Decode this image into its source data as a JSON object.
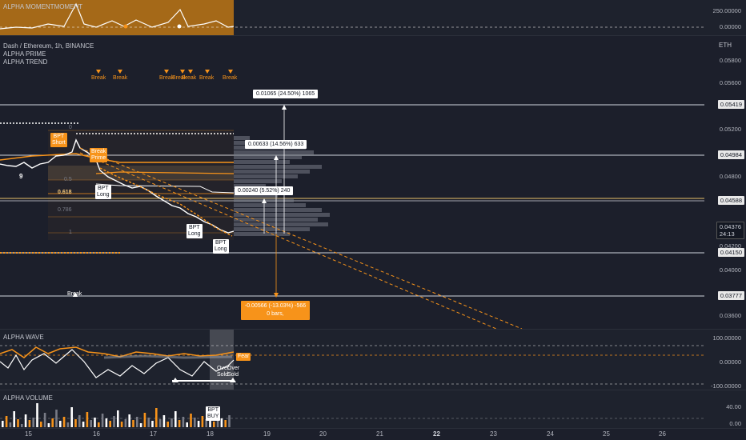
{
  "chart": {
    "symbol_line": "Dash / Ethereum, 1h, BINANCE",
    "indicators": [
      "ALPHA PRIME",
      "ALPHA TREND"
    ],
    "currency": "ETH",
    "top_pane_title": "ALPHA MOMENTMOMENT",
    "wave_pane_title": "ALPHA WAVE",
    "volume_pane_title": "ALPHA VOLUME"
  },
  "price_axis": {
    "ticks": [
      "0.05800",
      "0.05600",
      "0.05200",
      "0.04800",
      "0.04200",
      "0.04000",
      "0.03600"
    ],
    "tags": {
      "t05419": "0.05419",
      "t04984": "0.04984",
      "t04588": "0.04588",
      "t04376": "0.04376",
      "countdown": "24:13",
      "t04150": "0.04150",
      "t03777": "0.03777"
    }
  },
  "top_axis": {
    "t1": "250.00000",
    "t2": "0.00000"
  },
  "wave_axis": {
    "t1": "100.00000",
    "t2": "0.00000",
    "t3": "-100.00000"
  },
  "vol_axis": {
    "t1": "40.00",
    "t2": "0.00"
  },
  "time_axis": [
    "15",
    "16",
    "17",
    "18",
    "19",
    "20",
    "21",
    "22",
    "23",
    "24",
    "25",
    "26"
  ],
  "fib": {
    "f0": "0",
    "f05": "0.5",
    "f0618": "0.618",
    "f0786": "0.786",
    "f1": "1"
  },
  "annotations": {
    "a1": "0.01065 (24.50%) 1065",
    "a2": "0.00633 (14.56%) 633",
    "a3": "0.00240 (5.52%) 240",
    "a4_line1": "-0.00566 (-13.03%) -566",
    "a4_line2": "0 bars,"
  },
  "signals": {
    "break": "Break",
    "bpt": "BPT",
    "short": "Short",
    "prime": "Prime",
    "long": "Long",
    "buy": "BUY",
    "fear": "Fear",
    "over": "Over",
    "sold": "Sold",
    "nine": "9"
  },
  "colors": {
    "accent": "#f7931a",
    "bg": "#1c1f2b"
  }
}
